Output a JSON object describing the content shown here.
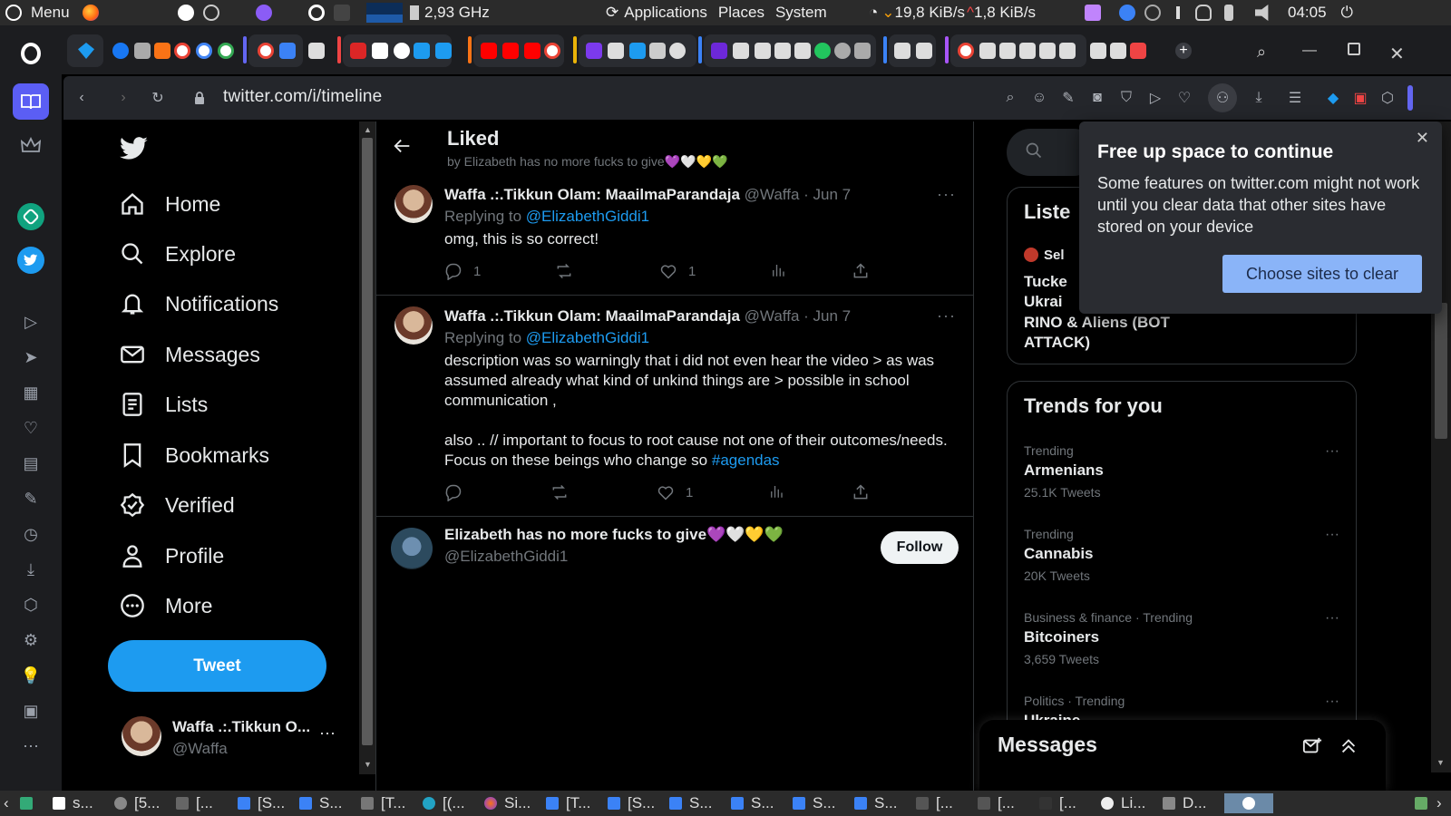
{
  "os_panel": {
    "menu_label": "Menu",
    "cpu_freq": "2,93 GHz",
    "applications": "Applications",
    "places": "Places",
    "system": "System",
    "net_down": "19,8 KiB/s",
    "net_up": "1,8 KiB/s",
    "clock": "04:05"
  },
  "browser": {
    "url": "twitter.com/i/timeline"
  },
  "nav": {
    "items": [
      {
        "label": "Home",
        "icon": "home-icon"
      },
      {
        "label": "Explore",
        "icon": "search-icon"
      },
      {
        "label": "Notifications",
        "icon": "bell-icon"
      },
      {
        "label": "Messages",
        "icon": "envelope-icon"
      },
      {
        "label": "Lists",
        "icon": "list-icon"
      },
      {
        "label": "Bookmarks",
        "icon": "bookmark-icon"
      },
      {
        "label": "Verified",
        "icon": "verified-icon"
      },
      {
        "label": "Profile",
        "icon": "person-icon"
      },
      {
        "label": "More",
        "icon": "more-circle-icon"
      }
    ],
    "tweet_button": "Tweet"
  },
  "account": {
    "name": "Waffa .:.Tikkun O...",
    "handle": "@Waffa"
  },
  "timeline": {
    "title": "Liked",
    "subtitle": "by Elizabeth has no more fucks to give💜🤍💛💚",
    "tweets": [
      {
        "name": "Waffa .:.Tikkun Olam: MaailmaParandaja",
        "meta": "@Waffa · Jun 7",
        "replying_prefix": "Replying to ",
        "replying_to": "@ElizabethGiddi1",
        "text": "omg, this is so correct!",
        "replies": "1",
        "likes": "1"
      },
      {
        "name": "Waffa .:.Tikkun Olam: MaailmaParandaja",
        "meta": "@Waffa · Jun 7",
        "replying_prefix": "Replying to ",
        "replying_to": "@ElizabethGiddi1",
        "text_p1": "description was so warningly that i did not even hear the video > as was assumed already what kind of unkind things are > possible in school communication ,",
        "text_p2": "also .. // important to focus to root cause not one of their outcomes/needs. Focus on these beings who change so ",
        "hashtag": "#agendas",
        "likes": "1"
      }
    ],
    "user_card": {
      "name": "Elizabeth has no more fucks to give💜🤍💛💚",
      "handle": "@ElizabethGiddi1",
      "follow": "Follow"
    }
  },
  "right": {
    "lists_heading": "Liste",
    "list_owner": "Sel",
    "list_title_1": "Tucke",
    "list_title_2": "Ukrai",
    "list_title_3": "RINO & Aliens (BOT",
    "list_title_4": "ATTACK)",
    "trends_heading": "Trends for you",
    "trends": [
      {
        "context": "Trending",
        "name": "Armenians",
        "count": "25.1K Tweets"
      },
      {
        "context": "Trending",
        "name": "Cannabis",
        "count": "20K Tweets"
      },
      {
        "context": "Business & finance · Trending",
        "name": "Bitcoiners",
        "count": "3,659 Tweets"
      },
      {
        "context": "Politics · Trending",
        "name": "Ukraine",
        "count": ""
      }
    ],
    "messages": "Messages"
  },
  "popup": {
    "title": "Free up space to continue",
    "body": "Some features on twitter.com might not work until you clear data that other sites have stored on your device",
    "button": "Choose sites to clear"
  },
  "taskbar": {
    "items": [
      "s...",
      "[5...",
      "[...",
      "[S...",
      "S...",
      "[T...",
      "[(...",
      "Si...",
      "[T...",
      "[S...",
      "S...",
      "S...",
      "S...",
      "[...",
      "[...",
      "[...",
      "Li...",
      "D..."
    ]
  },
  "colors": {
    "accent": "#1d9bf0",
    "background": "#000000",
    "text": "#e7e9ea",
    "muted": "#71767b",
    "popup_button": "#8ab4f8"
  }
}
